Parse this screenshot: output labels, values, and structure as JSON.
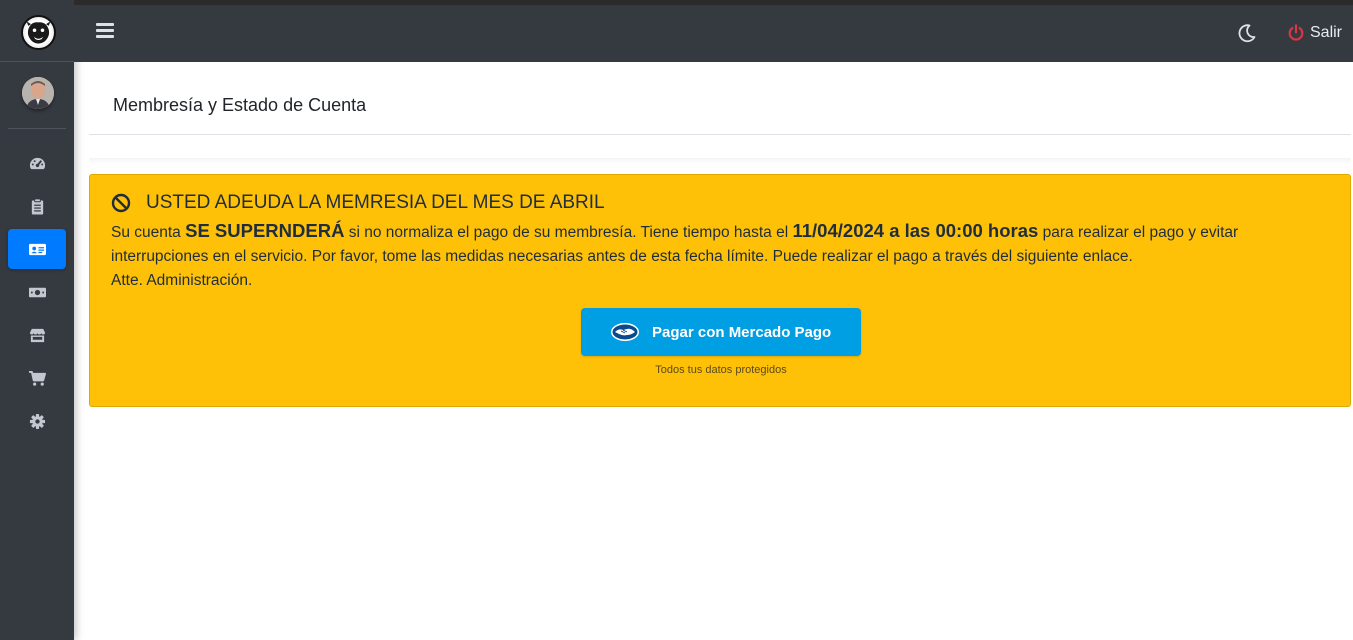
{
  "sidebar": {
    "brand_logo": "rottweiler-logo",
    "user_avatar": "user-avatar",
    "items": [
      {
        "icon": "tachometer-icon",
        "active": false
      },
      {
        "icon": "clipboard-icon",
        "active": false
      },
      {
        "icon": "id-card-icon",
        "active": true
      },
      {
        "icon": "money-bill-icon",
        "active": false
      },
      {
        "icon": "store-icon",
        "active": false
      },
      {
        "icon": "shopping-cart-icon",
        "active": false
      },
      {
        "icon": "gear-icon",
        "active": false
      }
    ]
  },
  "topbar": {
    "menu_icon": "bars-icon",
    "theme_icon": "moon-icon",
    "logout_label": "Salir",
    "logout_icon": "power-icon"
  },
  "page": {
    "title": "Membresía y Estado de Cuenta"
  },
  "alert": {
    "icon": "ban-icon",
    "title": "USTED ADEUDA LA MEMRESIA DEL MES DE ABRIL",
    "text_1": "Su cuenta ",
    "emphasis_1": "SE SUPERNDERÁ",
    "text_2": " si no normaliza el pago de su membresía. Tiene tiempo hasta el ",
    "emphasis_2": "11/04/2024 a las 00:00 horas",
    "text_3": " para realizar el pago y evitar interrupciones en el servicio. Por favor, tome las medidas necesarias antes de esta fecha límite. Puede realizar el pago a través del siguiente enlace.",
    "signature": "Atte. Administración.",
    "pay_button_label": "Pagar con Mercado Pago",
    "pay_note": "Todos tus datos protegidos"
  },
  "colors": {
    "sidebar_bg": "#343a40",
    "active_item": "#007bff",
    "alert_bg": "#ffc107",
    "mercadopago_blue": "#009ee3",
    "logout_red": "#dc3545"
  }
}
